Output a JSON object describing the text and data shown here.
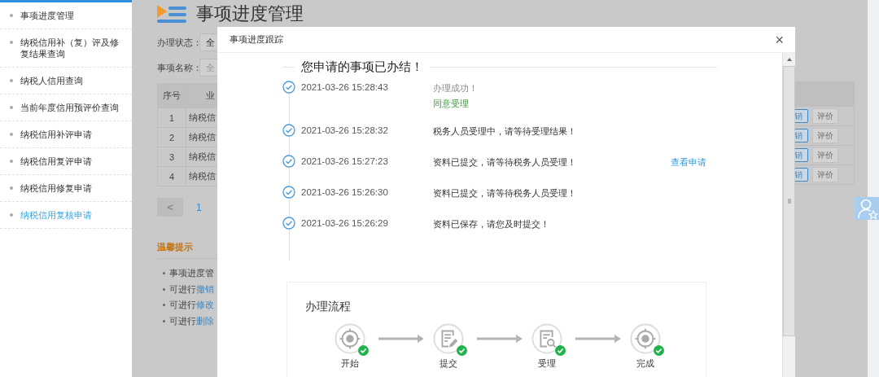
{
  "sidebar": {
    "items": [
      {
        "label": "事项进度管理",
        "selected": false
      },
      {
        "label": "纳税信用补（复）评及修复结果查询",
        "selected": false
      },
      {
        "label": "纳税人信用查询",
        "selected": false
      },
      {
        "label": "当前年度信用预评价查询",
        "selected": false
      },
      {
        "label": "纳税信用补评申请",
        "selected": false
      },
      {
        "label": "纳税信用复评申请",
        "selected": false
      },
      {
        "label": "纳税信用修复申请",
        "selected": false
      },
      {
        "label": "纳税信用复核申请",
        "selected": true
      }
    ]
  },
  "page": {
    "title": "事项进度管理",
    "filters": [
      {
        "label": "办理状态：",
        "kind": "select",
        "value": "全"
      },
      {
        "label": "事项名称：",
        "kind": "input",
        "placeholder": "全"
      }
    ],
    "table": {
      "columns": [
        "序号",
        "业"
      ],
      "rows": [
        [
          "1",
          "纳税信"
        ],
        [
          "2",
          "纳税信"
        ],
        [
          "3",
          "纳税信"
        ],
        [
          "4",
          "纳税信"
        ]
      ],
      "actions": [
        {
          "revoke": "销",
          "rate": "评价",
          "rate_disabled": true
        },
        {
          "revoke": "销",
          "rate": "评价",
          "rate_disabled": true
        },
        {
          "revoke": "销",
          "rate": "评价",
          "rate_disabled": true
        },
        {
          "revoke": "销",
          "rate": "评价",
          "rate_disabled": true
        }
      ]
    },
    "pagination": {
      "prev": "<",
      "pages": [
        {
          "label": "1",
          "selected": true
        }
      ]
    },
    "tips": {
      "title": "温馨提示",
      "items": [
        {
          "text": "事项进度管"
        },
        {
          "text": "可进行",
          "link": "撤销"
        },
        {
          "text": "可进行",
          "link": "修改"
        },
        {
          "text": "可进行",
          "link": "删除"
        }
      ]
    }
  },
  "modal": {
    "title": "事项进度跟踪",
    "close": "×",
    "heading": "您申请的事项已办结！",
    "events": [
      {
        "time": "2021-03-26 15:28:43",
        "message": "办理成功！",
        "kind": "result",
        "note": "同意受理"
      },
      {
        "time": "2021-03-26 15:28:32",
        "message": "税务人员受理中，请等待受理结果！",
        "kind": "normal"
      },
      {
        "time": "2021-03-26 15:27:23",
        "message": "资料已提交，请等待税务人员受理！",
        "kind": "normal",
        "link": "查看申请"
      },
      {
        "time": "2021-03-26 15:26:30",
        "message": "资料已提交，请等待税务人员受理！",
        "kind": "normal"
      },
      {
        "time": "2021-03-26 15:26:29",
        "message": "资料已保存，请您及时提交！",
        "kind": "normal"
      }
    ],
    "flow": {
      "title": "办理流程",
      "steps": [
        {
          "label": "开始",
          "kind": "start",
          "done": true
        },
        {
          "label": "提交",
          "kind": "submit",
          "done": true
        },
        {
          "label": "受理",
          "kind": "review",
          "done": true
        },
        {
          "label": "完成",
          "kind": "finish",
          "done": true
        }
      ]
    }
  }
}
